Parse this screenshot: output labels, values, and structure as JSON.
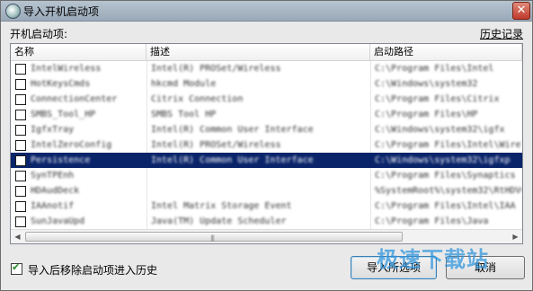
{
  "window": {
    "title": "导入开机启动项",
    "close_label": "✕"
  },
  "list_label": "开机启动项:",
  "history_link": "历史记录",
  "columns": [
    "名称",
    "描述",
    "启动路径"
  ],
  "rows": [
    {
      "name": "IntelWireless",
      "desc": "Intel(R) PROSet/Wireless",
      "path": "C:\\Program Files\\Intel",
      "selected": false
    },
    {
      "name": "HotKeysCmds",
      "desc": "hkcmd Module",
      "path": "C:\\Windows\\system32",
      "selected": false
    },
    {
      "name": "ConnectionCenter",
      "desc": "Citrix Connection",
      "path": "C:\\Program Files\\Citrix",
      "selected": false
    },
    {
      "name": "SMBS_Tool_HP",
      "desc": "SMBS Tool HP",
      "path": "C:\\Program Files\\HP",
      "selected": false
    },
    {
      "name": "IgfxTray",
      "desc": "Intel(R) Common User Interface",
      "path": "C:\\Windows\\system32\\igfx",
      "selected": false
    },
    {
      "name": "IntelZeroConfig",
      "desc": "Intel(R) PROSet/Wireless",
      "path": "C:\\Program Files\\Intel\\Wireless",
      "selected": false
    },
    {
      "name": "Persistence",
      "desc": "Intel(R) Common User Interface",
      "path": "C:\\Windows\\system32\\igfxp",
      "selected": true
    },
    {
      "name": "SynTPEnh",
      "desc": "",
      "path": "C:\\Program Files\\Synaptics",
      "selected": false
    },
    {
      "name": "HDAudDeck",
      "desc": "",
      "path": "%SystemRoot%\\system32\\RtHDVCpl",
      "selected": false
    },
    {
      "name": "IAAnotif",
      "desc": "Intel Matrix Storage Event",
      "path": "C:\\Program Files\\Intel\\IAA",
      "selected": false
    },
    {
      "name": "SunJavaUpd",
      "desc": "Java(TM) Update Scheduler",
      "path": "C:\\Program Files\\Java",
      "selected": false
    }
  ],
  "scrollbar": {
    "left_arrow": "◀",
    "right_arrow": "▶",
    "grip": "|||"
  },
  "move_to_history": {
    "label": "导入后移除启动项进入历史",
    "checked": true,
    "mark": "✔"
  },
  "buttons": {
    "import": "导入所选项",
    "cancel": "取消"
  },
  "watermark": "极速下载站"
}
